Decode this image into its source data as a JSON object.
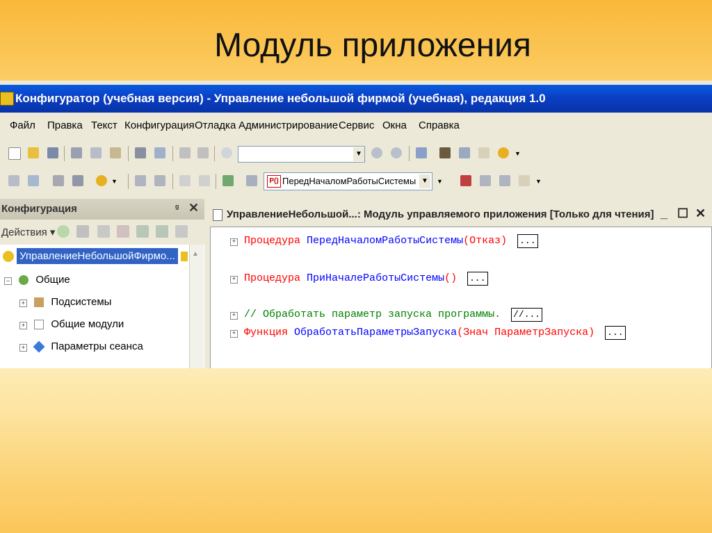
{
  "slide": {
    "title": "Модуль приложения"
  },
  "window": {
    "title": "Конфигуратор (учебная версия) - Управление небольшой фирмой (учебная), редакция 1.0"
  },
  "menu": [
    "Файл",
    "Правка",
    "Текст",
    "Конфигурация",
    "Отладка",
    "Администрирование",
    "Сервис",
    "Окна",
    "Справка"
  ],
  "toolbar": {
    "search_value": "",
    "procedure_tag": "P()",
    "procedure_value": "ПередНачаломРаботыСистемы"
  },
  "left_panel": {
    "title": "Конфигурация",
    "pin": "ᵍ",
    "close": "✕",
    "actions_label": "Действия ▾",
    "tree": [
      {
        "label": "УправлениеНебольшойФирмо...",
        "selected": true,
        "icon": "config-icon"
      },
      {
        "label": "Общие",
        "icon": "common-icon",
        "expand": "⊟"
      },
      {
        "label": "Подсистемы",
        "icon": "subsystems-icon",
        "expand": "⊞"
      },
      {
        "label": "Общие модули",
        "icon": "modules-icon",
        "expand": "⊞"
      },
      {
        "label": "Параметры сеанса",
        "icon": "session-params-icon",
        "expand": "⊞"
      }
    ]
  },
  "editor": {
    "title": "УправлениеНебольшой...: Модуль управляемого приложения [Только для чтения]",
    "controls": {
      "min": "_",
      "max": "☐",
      "close": "✕"
    },
    "lines": [
      {
        "kw": "Процедура",
        "name": "ПередНачаломРаботыСистемы",
        "args": "(Отказ)",
        "collapsed": "..."
      },
      {
        "kw": "Процедура",
        "name": "ПриНачалеРаботыСистемы",
        "args": "()",
        "collapsed": "..."
      },
      {
        "comment": "// Обработать параметр запуска программы.",
        "collapsed": "//..."
      },
      {
        "kw": "Функция",
        "name": "ОбработатьПараметрыЗапуска",
        "args": "(Знач ПараметрЗапуска)",
        "collapsed": "..."
      }
    ],
    "plus_sign": "⊞"
  },
  "colors": {
    "keyword": "#ff0000",
    "identifier": "#0000ff",
    "comment": "#008000",
    "titlebar": "#0b3fc4",
    "selection": "#3163c5"
  }
}
